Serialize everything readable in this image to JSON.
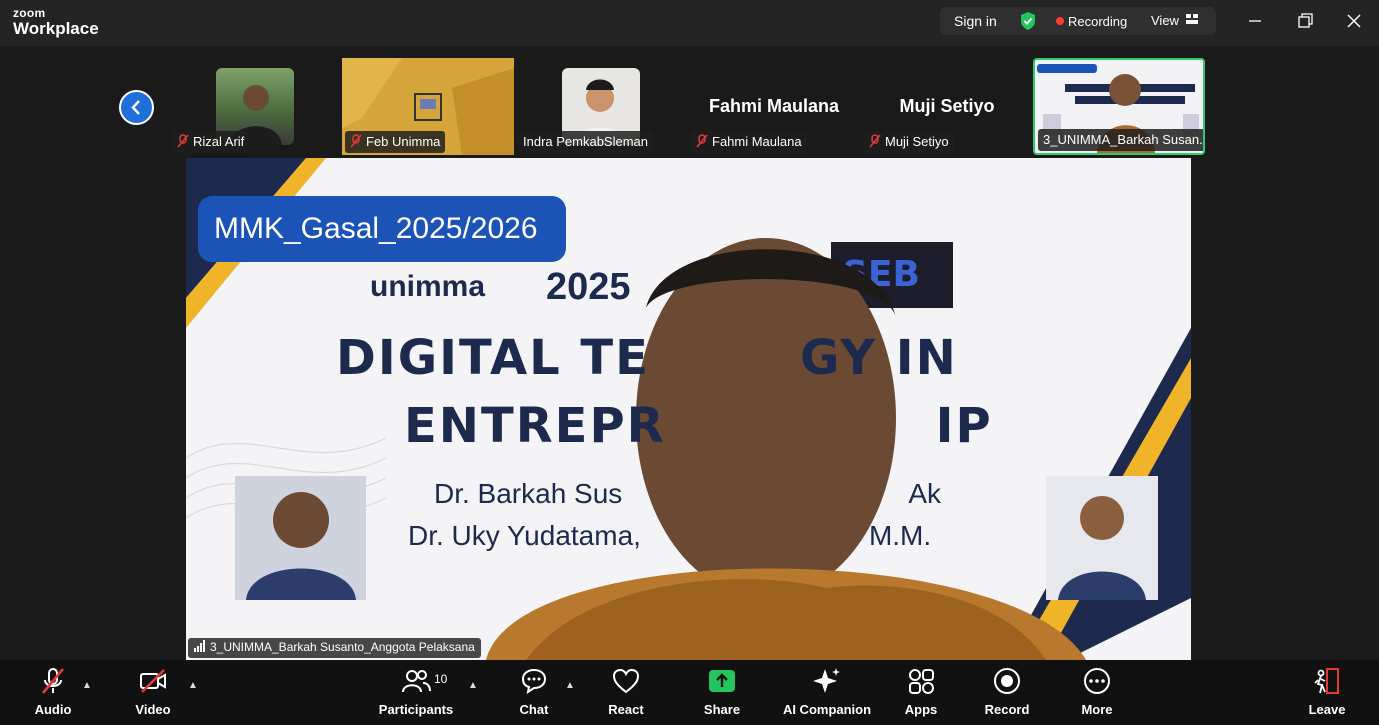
{
  "app": {
    "brand_top": "zoom",
    "brand_bottom": "Workplace"
  },
  "titlebar": {
    "sign_in": "Sign in",
    "recording": "Recording",
    "view": "View"
  },
  "gallery": [
    {
      "name": "Rizal Arif",
      "muted": true,
      "display": "photo"
    },
    {
      "name": "Feb Unimma",
      "muted": true,
      "display": "screen"
    },
    {
      "name": "Indra PemkabSleman",
      "muted": false,
      "display": "photo"
    },
    {
      "name": "Fahmi Maulana",
      "muted": true,
      "display": "name",
      "big_name": "Fahmi Maulana"
    },
    {
      "name": "Muji Setiyo",
      "muted": true,
      "display": "name",
      "big_name": "Muji Setiyo"
    },
    {
      "name": "3_UNIMMA_Barkah Susan...",
      "muted": false,
      "display": "photo",
      "active": true
    }
  ],
  "main": {
    "slide_label": "MMK_Gasal_2025/2026",
    "logo_text": "unimma",
    "year": "2025",
    "title_line1": "DIGITAL TE",
    "title_line1b": "GY IN",
    "title_line2": "ENTREPR",
    "title_line2b": "IP",
    "author1": "Dr. Barkah Sus",
    "author1b": "Ak",
    "author2": "Dr. Uky Yudatama,",
    "author2b": "M.M.",
    "speaker": "3_UNIMMA_Barkah Susanto_Anggota Pelaksana"
  },
  "toolbar": {
    "audio": "Audio",
    "video": "Video",
    "participants": "Participants",
    "participants_count": "10",
    "chat": "Chat",
    "react": "React",
    "share": "Share",
    "ai_companion": "AI Companion",
    "apps": "Apps",
    "record": "Record",
    "more": "More",
    "leave": "Leave"
  },
  "colors": {
    "share_green": "#22c55e",
    "active_border": "#2ecc71",
    "record_red": "#ff3b30",
    "nav_blue": "#1f6fd8"
  }
}
